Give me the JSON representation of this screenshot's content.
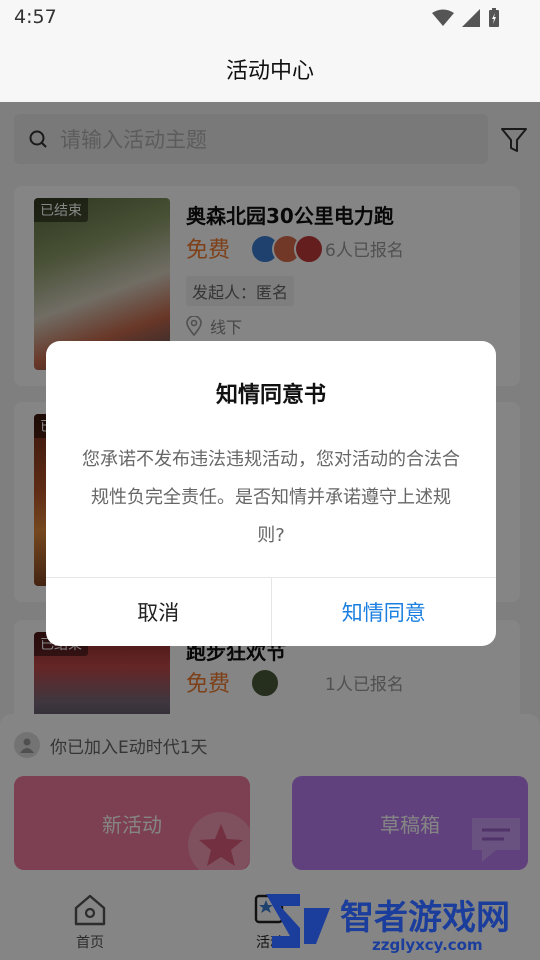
{
  "status": {
    "time": "4:57"
  },
  "header": {
    "title": "活动中心"
  },
  "search": {
    "placeholder": "请输入活动主题"
  },
  "activities": [
    {
      "badge": "已结束",
      "title": "奥森北园30公里电力跑",
      "price": "免费",
      "enrolled": "6人已报名",
      "organizer": "发起人：匿名",
      "location": "线下"
    },
    {
      "badge": "已结束",
      "title": "",
      "price": "",
      "enrolled": "",
      "organizer": "",
      "location": ""
    },
    {
      "badge": "已结束",
      "title": "跑步狂欢节",
      "price": "免费",
      "enrolled": "1人已报名"
    }
  ],
  "join_panel": {
    "info": "你已加入E动时代1天",
    "new_activity": "新活动",
    "drafts": "草稿箱"
  },
  "bottom_nav": [
    {
      "label": "首页"
    },
    {
      "label": "活动"
    }
  ],
  "dialog": {
    "title": "知情同意书",
    "body": "您承诺不发布违法违规活动，您对活动的合法合规性负完全责任。是否知情并承诺遵守上述规则?",
    "cancel": "取消",
    "confirm": "知情同意"
  },
  "watermark": {
    "text": "智者游戏网",
    "url": "zzglyxcy.com"
  },
  "colors": {
    "accent_blue": "#1a7fe0",
    "price_orange": "#f07c2f",
    "new_btn": "#f07a9d",
    "draft_btn": "#b87df0"
  }
}
